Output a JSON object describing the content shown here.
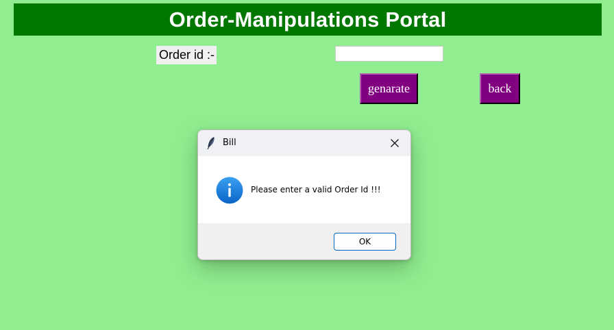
{
  "portal": {
    "title": "Order-Manipulations Portal",
    "order_id_label": "Order id :-",
    "order_id_value": "",
    "generate_label": "genarate",
    "back_label": "back"
  },
  "dialog": {
    "title": "Bill",
    "app_icon": "feather-icon",
    "close_icon": "close-icon",
    "message_icon": "info-icon",
    "message": "Please enter a valid Order Id !!!",
    "ok_label": "OK"
  },
  "colors": {
    "background": "#90EE90",
    "header": "#007800",
    "button": "#800080",
    "info_icon": "#1a7fd8",
    "ok_border": "#0067c0"
  }
}
